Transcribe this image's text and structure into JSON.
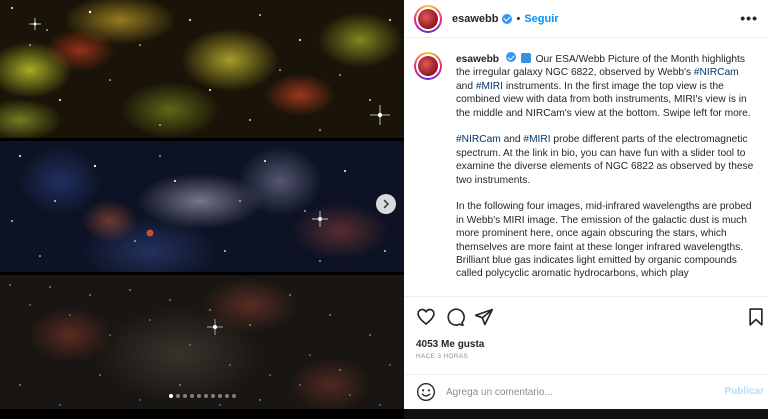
{
  "media": {
    "carousel": {
      "total": 10,
      "active_index": 0
    },
    "next_icon": "chevron-right-icon"
  },
  "header": {
    "username": "esawebb",
    "separator": "•",
    "follow_label": "Seguir",
    "more_icon": "more-horizontal-icon",
    "more_label": "•••"
  },
  "caption": {
    "author": "esawebb",
    "p1_lead": "Our ESA/Webb Picture of the Month highlights the irregular galaxy NGC 6822, observed by Webb's ",
    "tag_nircam": "#NIRCam",
    "p1_and": " and ",
    "tag_miri": "#MIRI",
    "p1_tail": " instruments. In the first image the top view is the combined view with data from both instruments, MIRI's view is in the middle and NIRCam's view at the bottom. Swipe left for more.",
    "p2_tag_nircam": "#NIRCam",
    "p2_and": " and ",
    "p2_tag_miri": "#MIRI",
    "p2_tail": " probe different parts of the electromagnetic spectrum. At the link in bio, you can have fun with a slider tool to examine the diverse elements of NGC 6822 as observed by these two instruments.",
    "p3": "In the following four images, mid-infrared wavelengths are probed in Webb's MIRI image. The emission of the galactic dust is much more prominent here, once again obscuring the stars, which themselves are more faint at these longer infrared wavelengths. Brilliant blue gas indicates light emitted by organic compounds called polycyclic aromatic hydrocarbons, which play"
  },
  "actions": {
    "like_icon": "heart-icon",
    "comment_icon": "comment-icon",
    "share_icon": "send-icon",
    "save_icon": "bookmark-icon"
  },
  "likes_text": "4053 Me gusta",
  "time_text": "HACE 3 HORAS",
  "comment": {
    "placeholder": "Agrega un comentario...",
    "publish_label": "Publicar",
    "emoji_icon": "smile-icon"
  },
  "colors": {
    "link_blue": "#0095f6",
    "hashtag": "#00376b",
    "publish_disabled": "#b2dffc",
    "verified": "#3897f0"
  }
}
